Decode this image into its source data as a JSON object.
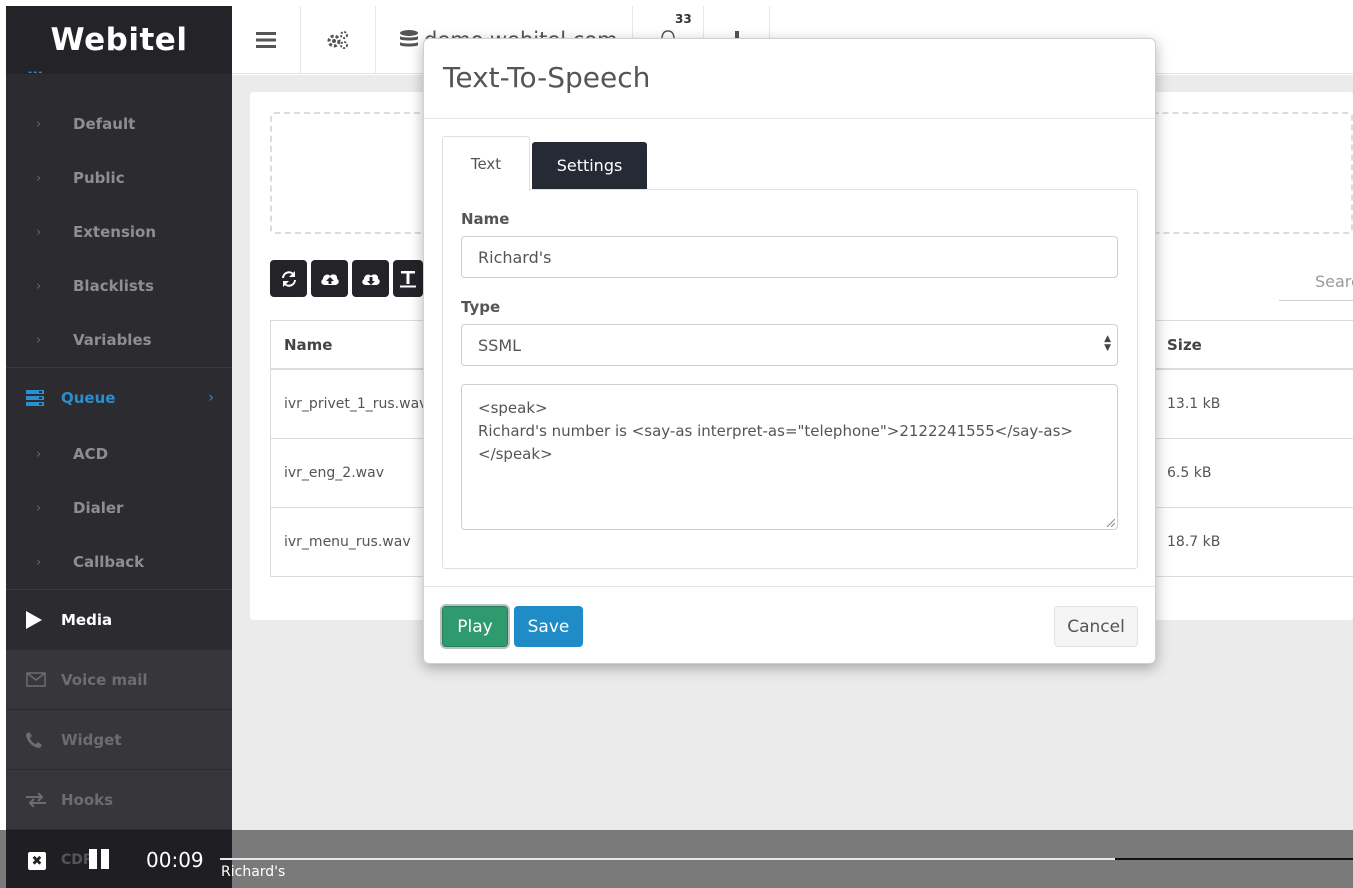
{
  "sidebar": {
    "logo": "Webitel",
    "logo_dots": "---",
    "sub_items_top": [
      {
        "label": "Default"
      },
      {
        "label": "Public"
      },
      {
        "label": "Extension"
      },
      {
        "label": "Blacklists"
      },
      {
        "label": "Variables"
      }
    ],
    "queue": {
      "label": "Queue"
    },
    "queue_items": [
      {
        "label": "ACD"
      },
      {
        "label": "Dialer"
      },
      {
        "label": "Callback"
      }
    ],
    "media": {
      "label": "Media"
    },
    "dark_items": [
      {
        "label": "Voice mail",
        "icon": "envelope-icon"
      },
      {
        "label": "Widget",
        "icon": "phone-icon"
      },
      {
        "label": "Hooks",
        "icon": "exchange-icon"
      }
    ]
  },
  "topbar": {
    "domain": "demo.webitel.com",
    "notifications_count": "33"
  },
  "media_page": {
    "search_placeholder": "Search",
    "table": {
      "headers": {
        "name": "Name",
        "size": "Size"
      },
      "rows": [
        {
          "name": "ivr_privet_1_rus.wav",
          "size": "13.1 kB"
        },
        {
          "name": "ivr_eng_2.wav",
          "size": "6.5 kB"
        },
        {
          "name": "ivr_menu_rus.wav",
          "size": "18.7 kB"
        }
      ]
    }
  },
  "modal": {
    "title": "Text-To-Speech",
    "tabs": {
      "text": "Text",
      "settings": "Settings"
    },
    "name_label": "Name",
    "name_value": "Richard's",
    "type_label": "Type",
    "type_value": "SSML",
    "text_value": "<speak>\nRichard's number is <say-as interpret-as=\"telephone\">2122241555</say-as>\n</speak>",
    "buttons": {
      "play": "Play",
      "save": "Save",
      "cancel": "Cancel"
    }
  },
  "player": {
    "cdr_label": "CDR",
    "time": "00:09",
    "track_name": "Richard's",
    "progress": 0.79
  }
}
